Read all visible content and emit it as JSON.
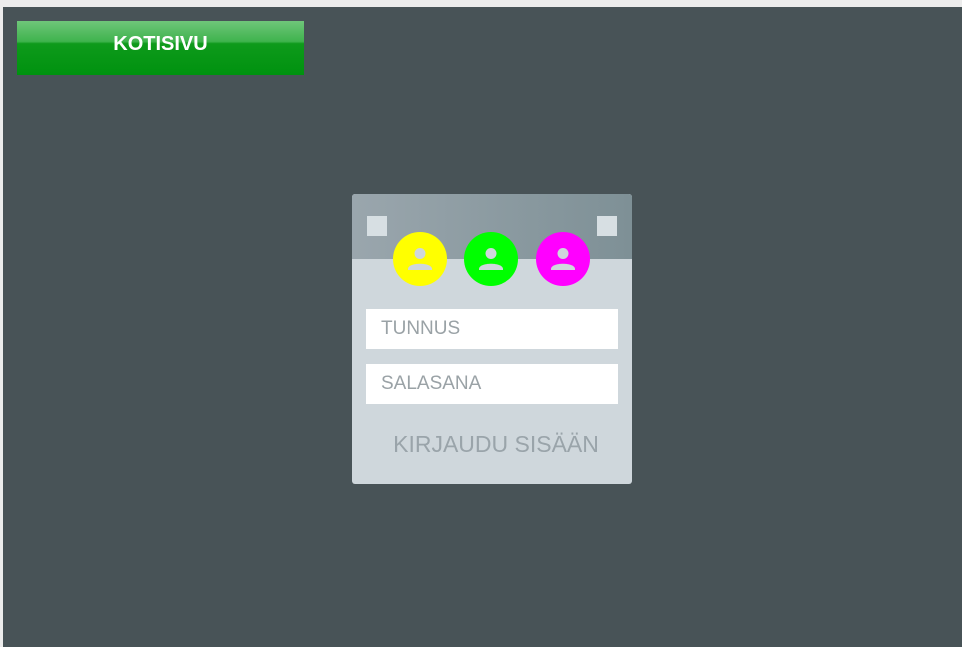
{
  "nav": {
    "home_label": "KOTISIVU",
    "color": "#00920f"
  },
  "login": {
    "username": {
      "placeholder": "TUNNUS",
      "value": ""
    },
    "password": {
      "placeholder": "SALASANA",
      "value": ""
    },
    "submit_label": "KIRJAUDU SISÄÄN",
    "avatars": [
      {
        "icon": "user-icon",
        "color": "#ffff00"
      },
      {
        "icon": "user-icon",
        "color": "#00ff00"
      },
      {
        "icon": "user-icon",
        "color": "#ff00ff"
      }
    ]
  },
  "theme": {
    "background": "#485357",
    "card": "#cfd7dc",
    "card_header": "#8a989e"
  }
}
